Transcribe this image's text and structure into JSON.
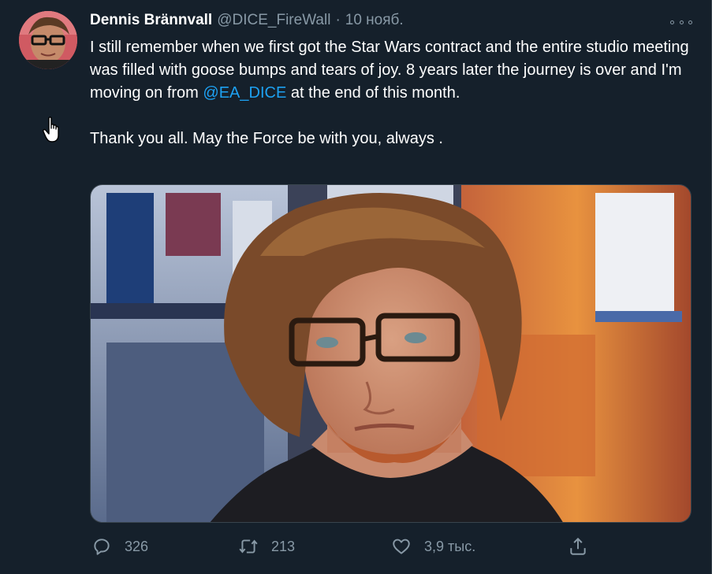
{
  "author": {
    "display_name": "Dennis Brännvall",
    "handle": "@DICE_FireWall",
    "separator": "·",
    "date": "10 нояб."
  },
  "tweet": {
    "line1_pre": "I still remember when we first got the Star Wars contract and the entire studio meeting was filled with goose bumps and tears of joy. 8 years later the journey is over and I'm moving on from ",
    "mention": "@EA_DICE",
    "line1_post": " at the end of this month.",
    "line2": "Thank you all. May the Force be with you, always ."
  },
  "actions": {
    "replies": "326",
    "retweets": "213",
    "likes": "3,9 тыс."
  },
  "icons": {
    "more": "more-horizontal-icon",
    "reply": "reply-icon",
    "retweet": "retweet-icon",
    "like": "heart-icon",
    "share": "share-icon",
    "cursor": "hand-pointer-icon"
  },
  "colors": {
    "background": "#15202b",
    "text": "#ffffff",
    "secondary": "#8899a6",
    "link": "#1da1f2",
    "border": "#38444d"
  }
}
